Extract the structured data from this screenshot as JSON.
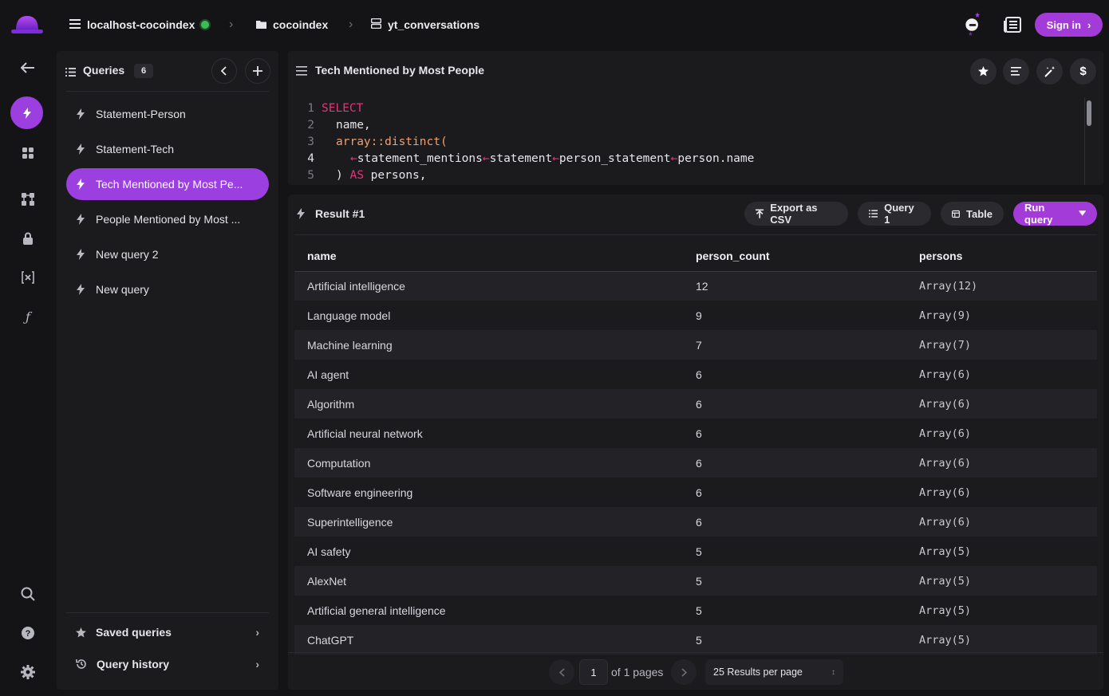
{
  "topbar": {
    "connection": "localhost-cocoindex",
    "database": "cocoindex",
    "collection": "yt_conversations",
    "signin_label": "Sign in"
  },
  "queries": {
    "title": "Queries",
    "count": "6",
    "items": [
      {
        "label": "Statement-Person"
      },
      {
        "label": "Statement-Tech"
      },
      {
        "label": "Tech Mentioned by Most Pe..."
      },
      {
        "label": "People Mentioned by Most ..."
      },
      {
        "label": "New query 2"
      },
      {
        "label": "New query"
      }
    ],
    "saved_label": "Saved queries",
    "history_label": "Query history"
  },
  "editor": {
    "title": "Tech Mentioned by Most People",
    "lines": [
      {
        "n": "1"
      },
      {
        "n": "2"
      },
      {
        "n": "3"
      },
      {
        "n": "4"
      },
      {
        "n": "5"
      }
    ],
    "code": {
      "l1_kw": "SELECT",
      "l2": "name,",
      "l3_fn": "array::distinct(",
      "l4_a": "←",
      "l4_b": "statement_mentions",
      "l4_c": "←",
      "l4_d": "statement",
      "l4_e": "←",
      "l4_f": "person_statement",
      "l4_g": "←",
      "l4_h": "person.name",
      "l5_a": ") ",
      "l5_kw": "AS",
      "l5_b": " persons,"
    }
  },
  "result": {
    "title": "Result #1",
    "export_label": "Export as CSV",
    "query_label": "Query 1",
    "view_label": "Table",
    "run_label": "Run query",
    "columns": [
      "name",
      "person_count",
      "persons"
    ],
    "rows": [
      [
        "Artificial intelligence",
        "12",
        "Array(12)"
      ],
      [
        "Language model",
        "9",
        "Array(9)"
      ],
      [
        "Machine learning",
        "7",
        "Array(7)"
      ],
      [
        "AI agent",
        "6",
        "Array(6)"
      ],
      [
        "Algorithm",
        "6",
        "Array(6)"
      ],
      [
        "Artificial neural network",
        "6",
        "Array(6)"
      ],
      [
        "Computation",
        "6",
        "Array(6)"
      ],
      [
        "Software engineering",
        "6",
        "Array(6)"
      ],
      [
        "Superintelligence",
        "6",
        "Array(6)"
      ],
      [
        "AI safety",
        "5",
        "Array(5)"
      ],
      [
        "AlexNet",
        "5",
        "Array(5)"
      ],
      [
        "Artificial general intelligence",
        "5",
        "Array(5)"
      ],
      [
        "ChatGPT",
        "5",
        "Array(5)"
      ]
    ],
    "pager": {
      "page": "1",
      "of_text": "of 1 pages",
      "per_page": "25 Results per page"
    }
  },
  "colors": {
    "accent": "#9b3fe0",
    "background": "#141416",
    "panel": "#1b1b1e"
  }
}
